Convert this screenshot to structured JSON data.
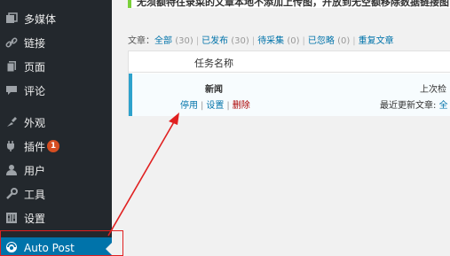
{
  "sidebar": {
    "items": [
      {
        "label": "多媒体",
        "icon": "media-icon"
      },
      {
        "label": "链接",
        "icon": "link-icon"
      },
      {
        "label": "页面",
        "icon": "page-icon"
      },
      {
        "label": "评论",
        "icon": "comment-icon"
      },
      {
        "label": "外观",
        "icon": "appearance-icon"
      },
      {
        "label": "插件",
        "icon": "plugin-icon",
        "badge": "1"
      },
      {
        "label": "用户",
        "icon": "user-icon"
      },
      {
        "label": "工具",
        "icon": "tools-icon"
      },
      {
        "label": "设置",
        "icon": "settings-icon"
      },
      {
        "label": "Auto Post",
        "icon": "autopost-icon",
        "active": true
      }
    ]
  },
  "notice": {
    "text": "无须额特往录菜的文章本地不添加上传图，开放到无空额移除数据链接图"
  },
  "filters": {
    "prefix": "文章：",
    "all": "全部",
    "all_count": "(30)",
    "published": "已发布",
    "published_count": "(30)",
    "pending": "待采集",
    "pending_count": "(0)",
    "ignored": "已忽略",
    "ignored_count": "(0)",
    "duplicate": "重复文章"
  },
  "table": {
    "header_name": "任务名称",
    "row": {
      "name": "新闻",
      "action_disable": "停用",
      "action_settings": "设置",
      "action_delete": "删除",
      "meta_last": "上次检",
      "meta_updated_label": "最近更新文章:",
      "meta_updated_value": "全"
    }
  },
  "colors": {
    "sidebar_bg": "#23282d",
    "accent": "#0073aa",
    "annotation": "#e02020",
    "badge": "#d54e21"
  }
}
